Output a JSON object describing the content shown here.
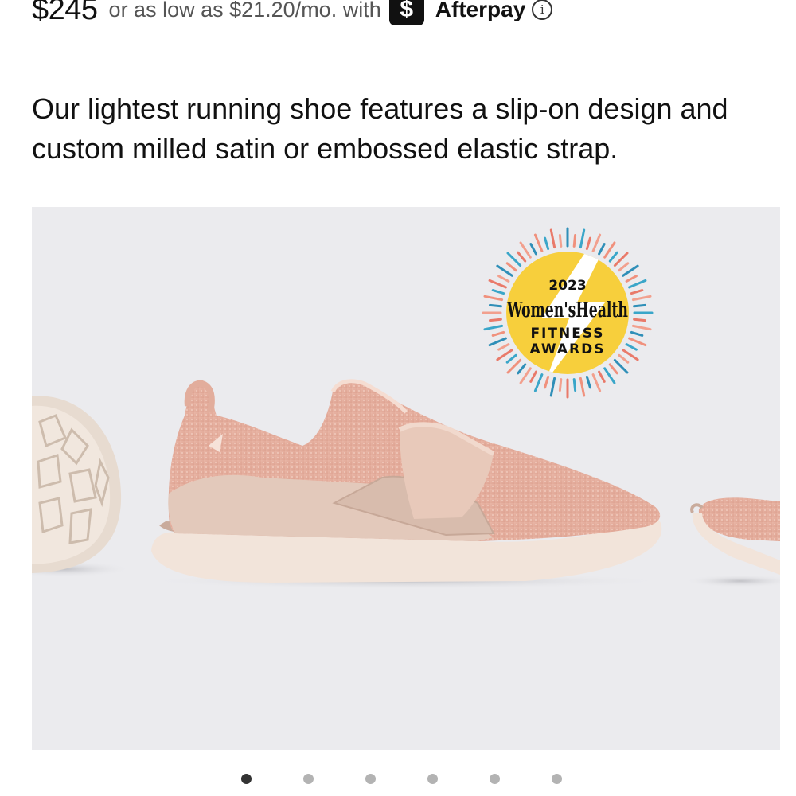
{
  "price": {
    "amount": "$245",
    "installment_text": "or as low as $21.20/mo. with",
    "afterpay_badge_glyph": "$",
    "afterpay_label": "Afterpay",
    "info_icon_glyph": "i"
  },
  "description": "Our lightest running shoe features a slip-on design and custom milled satin or embossed elastic strap.",
  "gallery": {
    "award_badge": {
      "year": "2023",
      "brand": "Women'sHealth",
      "line1": "FITNESS",
      "line2": "AWARDS"
    },
    "product_color": "#e8b8a8",
    "background_color": "#ebebee"
  },
  "carousel": {
    "total_slides": 6,
    "active_index": 0
  },
  "colors": {
    "badge_yellow": "#f7cf3c",
    "text_primary": "#111111",
    "text_secondary": "#555555"
  }
}
